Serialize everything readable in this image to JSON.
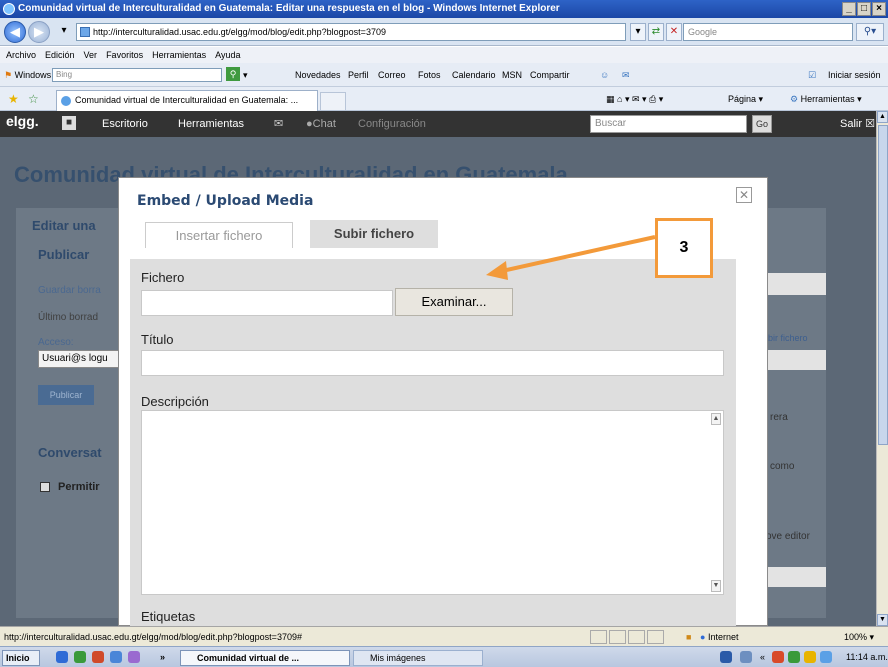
{
  "window": {
    "title": "Comunidad virtual de Interculturalidad en Guatemala: Editar una respuesta en el blog - Windows Internet Explorer",
    "controls": [
      "_",
      "□",
      "×"
    ]
  },
  "address_bar": {
    "url": "http://interculturalidad.usac.edu.gt/elgg/mod/blog/edit.php?blogpost=3709",
    "search_placeholder": "Google",
    "search_icon": "magnifier-icon"
  },
  "menu": [
    "Archivo",
    "Edición",
    "Ver",
    "Favoritos",
    "Herramientas",
    "Ayuda"
  ],
  "links_bar": {
    "windows_live": "Windows Live",
    "bing_placeholder": "Bing",
    "items": [
      "Novedades",
      "Perfil",
      "Correo",
      "Fotos",
      "Calendario",
      "MSN",
      "Compartir"
    ],
    "signin": "Iniciar sesión"
  },
  "tabs": {
    "active": "Comunidad virtual de Interculturalidad en Guatemala: ...",
    "page_menu": "Página",
    "tools_menu": "Herramientas"
  },
  "elgg_bar": {
    "logo": "elgg.",
    "items": [
      "Escritorio",
      "Herramientas",
      "Chat",
      "Configuración"
    ],
    "search_placeholder": "Buscar",
    "go": "Go",
    "logout": "Salir"
  },
  "page": {
    "title": "Comunidad virtual de Interculturalidad en Guatemala",
    "left": {
      "editar": "Editar una",
      "publicar_heading": "Publicar",
      "guardar": "Guardar borra",
      "ultimo": "Último borrad",
      "acceso": "Acceso:",
      "acceso_value": "Usuari@s logu",
      "publicar_btn": "Publicar",
      "conversation": "Conversat",
      "permitir": "Permitir"
    },
    "right": {
      "subir": "bir fichero",
      "rera": "rera",
      "como": "como",
      "editor": "ove editor"
    }
  },
  "modal": {
    "title": "Embed / Upload Media",
    "tab_insert": "Insertar fichero",
    "tab_upload": "Subir fichero",
    "file_label": "Fichero",
    "browse_button": "Examinar...",
    "title_label": "Título",
    "description_label": "Descripción",
    "tags_label": "Etiquetas"
  },
  "annotation": {
    "number": "3",
    "color": "#f39a3a"
  },
  "status_bar": {
    "url": "http://interculturalidad.usac.edu.gt/elgg/mod/blog/edit.php?blogpost=3709#",
    "zone": "Internet",
    "zoom": "100%"
  },
  "taskbar": {
    "start": "Inicio",
    "task1": "Comunidad virtual de ...",
    "task2": "Mis imágenes",
    "clock": "11:14 a.m."
  }
}
